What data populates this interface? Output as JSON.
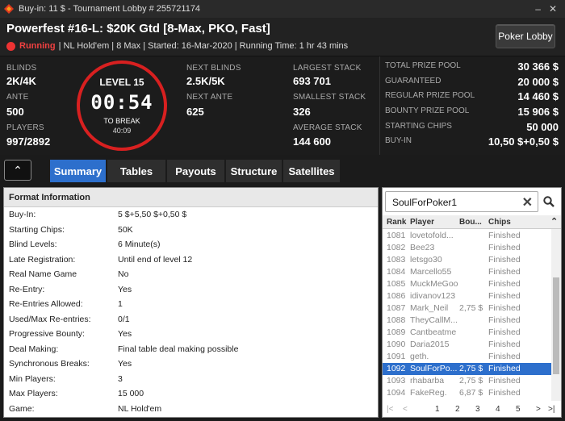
{
  "window": {
    "title": "Buy-in: 11 $ - Tournament Lobby # 255721174",
    "min_glyph": "–",
    "close_glyph": "✕"
  },
  "header": {
    "name": "Powerfest #16-L: $20K Gtd [8-Max, PKO, Fast]",
    "status": "Running",
    "info": "| NL Hold'em | 8 Max | Started: 16-Mar-2020 | Running Time: 1 hr  43 mins",
    "lobby_button": "Poker Lobby"
  },
  "stats": {
    "blinds_label": "BLINDS",
    "blinds": "2K/4K",
    "ante_label": "ANTE",
    "ante": "500",
    "players_label": "PLAYERS",
    "players": "997/2892",
    "level": "LEVEL 15",
    "clock": "00:54",
    "to_break_label": "TO BREAK",
    "to_break": "40:09",
    "next_blinds_label": "NEXT BLINDS",
    "next_blinds": "2.5K/5K",
    "next_ante_label": "NEXT ANTE",
    "next_ante": "625",
    "largest_label": "LARGEST STACK",
    "largest": "693 701",
    "smallest_label": "SMALLEST STACK",
    "smallest": "326",
    "average_label": "AVERAGE STACK",
    "average": "144 600"
  },
  "prizes": [
    {
      "label": "TOTAL PRIZE POOL",
      "value": "30 366 $"
    },
    {
      "label": "GUARANTEED",
      "value": "20 000 $"
    },
    {
      "label": "REGULAR PRIZE POOL",
      "value": "14 460 $"
    },
    {
      "label": "BOUNTY PRIZE POOL",
      "value": "15 906 $"
    },
    {
      "label": "STARTING CHIPS",
      "value": "50 000"
    },
    {
      "label": "BUY-IN",
      "value": "10,50 $+0,50 $"
    }
  ],
  "tabs": [
    "Summary",
    "Tables",
    "Payouts",
    "Structure",
    "Satellites"
  ],
  "collapse_glyph": "⌃",
  "format": {
    "heading": "Format Information",
    "rows": [
      {
        "k": "Buy-In:",
        "v": "5 $+5,50 $+0,50 $"
      },
      {
        "k": "Starting Chips:",
        "v": "50K"
      },
      {
        "k": "Blind Levels:",
        "v": "6 Minute(s)"
      },
      {
        "k": "Late Registration:",
        "v": "Until end of level 12"
      },
      {
        "k": "Real Name Game",
        "v": "No"
      },
      {
        "k": "Re-Entry:",
        "v": "Yes"
      },
      {
        "k": "Re-Entries Allowed:",
        "v": "1"
      },
      {
        "k": "Used/Max Re-entries:",
        "v": "0/1"
      },
      {
        "k": "Progressive Bounty:",
        "v": "Yes"
      },
      {
        "k": "Deal Making:",
        "v": "Final table deal making possible"
      },
      {
        "k": "Synchronous Breaks:",
        "v": "Yes"
      },
      {
        "k": "Min Players:",
        "v": "3"
      },
      {
        "k": "Max Players:",
        "v": "15 000"
      },
      {
        "k": "Game:",
        "v": "NL Hold'em"
      }
    ]
  },
  "players": {
    "search_value": "SoulForPoker1",
    "columns": [
      "Rank",
      "Player",
      "Bou...",
      "Chips"
    ],
    "rows": [
      {
        "rank": "1081",
        "player": "lovetofold...",
        "bounty": "",
        "chips": "Finished"
      },
      {
        "rank": "1082",
        "player": "Bee23",
        "bounty": "",
        "chips": "Finished"
      },
      {
        "rank": "1083",
        "player": "letsgo30",
        "bounty": "",
        "chips": "Finished"
      },
      {
        "rank": "1084",
        "player": "Marcello55",
        "bounty": "",
        "chips": "Finished"
      },
      {
        "rank": "1085",
        "player": "MuckMeGoo",
        "bounty": "",
        "chips": "Finished"
      },
      {
        "rank": "1086",
        "player": "idivanov123",
        "bounty": "",
        "chips": "Finished"
      },
      {
        "rank": "1087",
        "player": "Mark_Neil",
        "bounty": "2,75 $",
        "chips": "Finished"
      },
      {
        "rank": "1088",
        "player": "TheyCallM...",
        "bounty": "",
        "chips": "Finished"
      },
      {
        "rank": "1089",
        "player": "Cantbeatme",
        "bounty": "",
        "chips": "Finished"
      },
      {
        "rank": "1090",
        "player": "Daria2015",
        "bounty": "",
        "chips": "Finished"
      },
      {
        "rank": "1091",
        "player": "geth.",
        "bounty": "",
        "chips": "Finished"
      },
      {
        "rank": "1092",
        "player": "SoulForPo...",
        "bounty": "2,75 $",
        "chips": "Finished"
      },
      {
        "rank": "1093",
        "player": "rhabarba",
        "bounty": "2,75 $",
        "chips": "Finished"
      },
      {
        "rank": "1094",
        "player": "FakeReg.",
        "bounty": "6,87 $",
        "chips": "Finished"
      }
    ],
    "selected_index": 11,
    "pages": [
      "1",
      "2",
      "3",
      "4",
      "5"
    ],
    "first_glyph": "|<",
    "prev_glyph": "<",
    "next_glyph": ">",
    "last_glyph": ">|"
  }
}
